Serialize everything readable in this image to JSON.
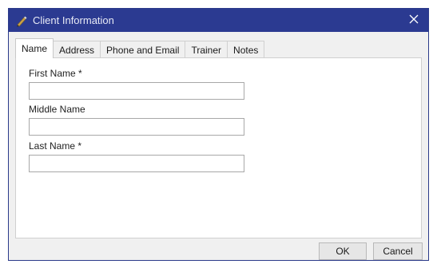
{
  "window": {
    "title": "Client Information",
    "icon": "pen-icon",
    "close_glyph": "✕"
  },
  "tabs": [
    {
      "label": "Name",
      "active": true
    },
    {
      "label": "Address",
      "active": false
    },
    {
      "label": "Phone and Email",
      "active": false
    },
    {
      "label": "Trainer",
      "active": false
    },
    {
      "label": "Notes",
      "active": false
    }
  ],
  "form": {
    "first_name": {
      "label": "First Name *",
      "value": ""
    },
    "middle_name": {
      "label": "Middle Name",
      "value": ""
    },
    "last_name": {
      "label": "Last Name *",
      "value": ""
    }
  },
  "buttons": {
    "ok": "OK",
    "cancel": "Cancel"
  },
  "colors": {
    "titlebar": "#2b3a91",
    "window_bg": "#f0f0f0"
  }
}
